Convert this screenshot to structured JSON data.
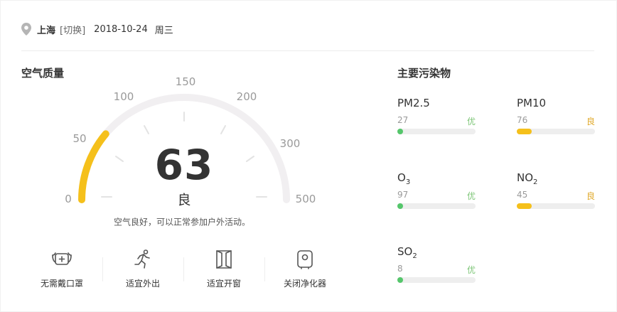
{
  "header": {
    "city": "上海",
    "switch_label": "[切换]",
    "date": "2018-10-24",
    "weekday": "周三"
  },
  "aqi_section": {
    "title": "空气质量",
    "value": "63",
    "level": "良",
    "advice": "空气良好，可以正常参加户外活动。",
    "scale_labels": [
      "0",
      "50",
      "100",
      "150",
      "200",
      "300",
      "500"
    ],
    "gauge_color": "#f5c01b",
    "track_color": "#f1eff1"
  },
  "tips": [
    {
      "label": "无需戴口罩",
      "icon": "mask-icon"
    },
    {
      "label": "适宜外出",
      "icon": "running-icon"
    },
    {
      "label": "适宜开窗",
      "icon": "window-icon"
    },
    {
      "label": "关闭净化器",
      "icon": "air-purifier-icon"
    }
  ],
  "pollutants_section": {
    "title": "主要污染物",
    "items": [
      {
        "name": "PM2.5",
        "value": "27",
        "level": "优",
        "color": "#55c66b",
        "fill": 0.04
      },
      {
        "name": "PM10",
        "value": "76",
        "level": "良",
        "color": "#f5c01b",
        "fill": 0.19
      },
      {
        "name": "O",
        "sub": "3",
        "value": "97",
        "level": "优",
        "color": "#55c66b",
        "fill": 0.04
      },
      {
        "name": "NO",
        "sub": "2",
        "value": "45",
        "level": "良",
        "color": "#f5c01b",
        "fill": 0.19
      },
      {
        "name": "SO",
        "sub": "2",
        "value": "8",
        "level": "优",
        "color": "#55c66b",
        "fill": 0.04
      }
    ]
  },
  "colors": {
    "good": "#55c66b",
    "moderate": "#f5c01b",
    "level_good_text": "#7cc576",
    "level_moderate_text": "#e0a92a"
  }
}
